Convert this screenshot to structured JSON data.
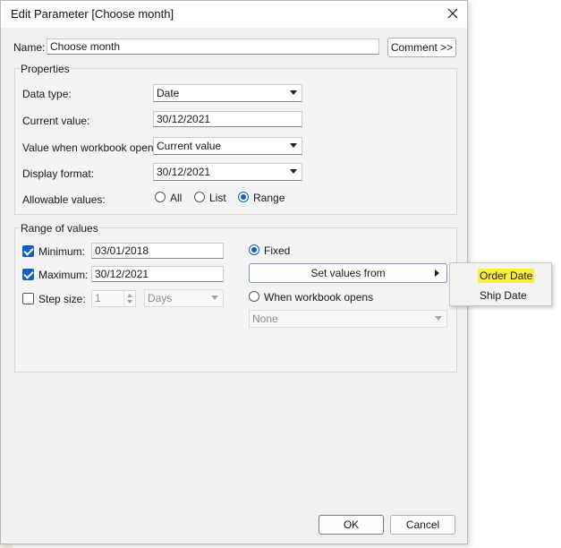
{
  "dialog": {
    "title": "Edit Parameter [Choose month]",
    "name_label": "Name:",
    "name_value": "Choose month",
    "comment_button": "Comment >>"
  },
  "properties": {
    "group_title": "Properties",
    "data_type_label": "Data type:",
    "data_type_value": "Date",
    "current_value_label": "Current value:",
    "current_value": "30/12/2021",
    "workbook_opens_label": "Value when workbook opens:",
    "workbook_opens_value": "Current value",
    "display_format_label": "Display format:",
    "display_format_value": "30/12/2021",
    "allowable_label": "Allowable values:",
    "allowable_options": [
      "All",
      "List",
      "Range"
    ],
    "allowable_selected": "Range"
  },
  "range": {
    "group_title": "Range of values",
    "minimum_label": "Minimum:",
    "minimum_value": "03/01/2018",
    "minimum_checked": true,
    "maximum_label": "Maximum:",
    "maximum_value": "30/12/2021",
    "maximum_checked": true,
    "step_label": "Step size:",
    "step_value": "1",
    "step_checked": false,
    "step_unit": "Days",
    "fixed_label": "Fixed",
    "fixed_selected": true,
    "set_values_button": "Set values from",
    "when_opens_label": "When workbook opens",
    "when_opens_value": "None"
  },
  "popup": {
    "items": [
      "Order Date",
      "Ship Date"
    ],
    "highlighted": "Order Date",
    "highlight_color": "#f7ef3b"
  },
  "footer": {
    "ok_label": "OK",
    "cancel_label": "Cancel"
  },
  "colors": {
    "accent": "#0f5fc4",
    "dialog_bg": "#f0f0f0"
  }
}
